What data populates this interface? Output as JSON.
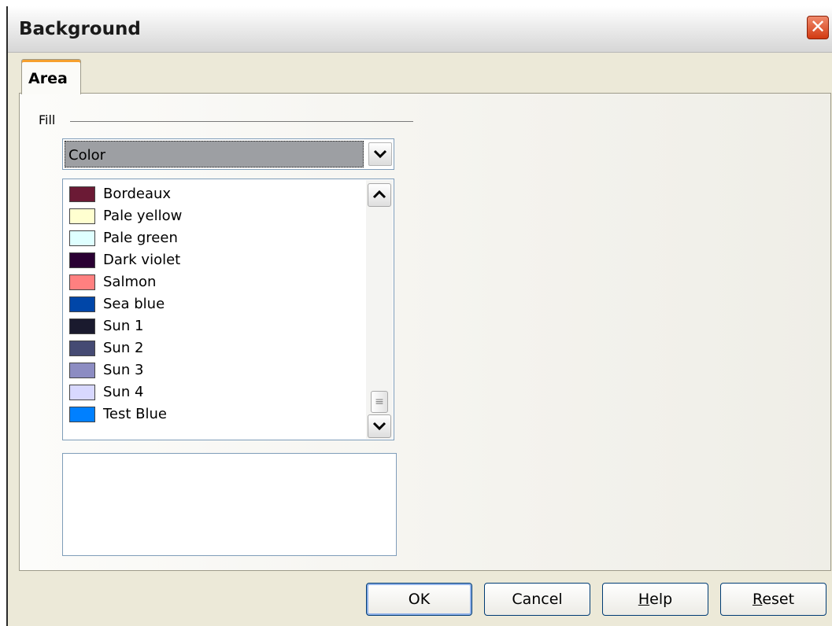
{
  "window": {
    "title": "Background",
    "close_glyph": "✕"
  },
  "tabs": [
    {
      "label": "Area"
    }
  ],
  "fill": {
    "label": "Fill",
    "type_value": "Color",
    "colors": [
      {
        "name": "Bordeaux",
        "hex": "#6b1a35"
      },
      {
        "name": "Pale yellow",
        "hex": "#ffffd0"
      },
      {
        "name": "Pale green",
        "hex": "#dfffff"
      },
      {
        "name": "Dark violet",
        "hex": "#2a0033"
      },
      {
        "name": "Salmon",
        "hex": "#ff8080"
      },
      {
        "name": "Sea blue",
        "hex": "#0046a8"
      },
      {
        "name": "Sun 1",
        "hex": "#1a1a2e"
      },
      {
        "name": "Sun 2",
        "hex": "#454a73"
      },
      {
        "name": "Sun 3",
        "hex": "#8c8cc2"
      },
      {
        "name": "Sun 4",
        "hex": "#d8d8ff"
      },
      {
        "name": "Test Blue",
        "hex": "#0080ff"
      }
    ]
  },
  "scrollbar": {
    "up_glyph": "▲",
    "down_glyph": "▼",
    "grip_glyph": "≡"
  },
  "buttons": {
    "ok": "OK",
    "cancel": "Cancel",
    "help_mnemonic": "H",
    "help_rest": "elp",
    "reset_mnemonic": "R",
    "reset_rest": "eset"
  }
}
